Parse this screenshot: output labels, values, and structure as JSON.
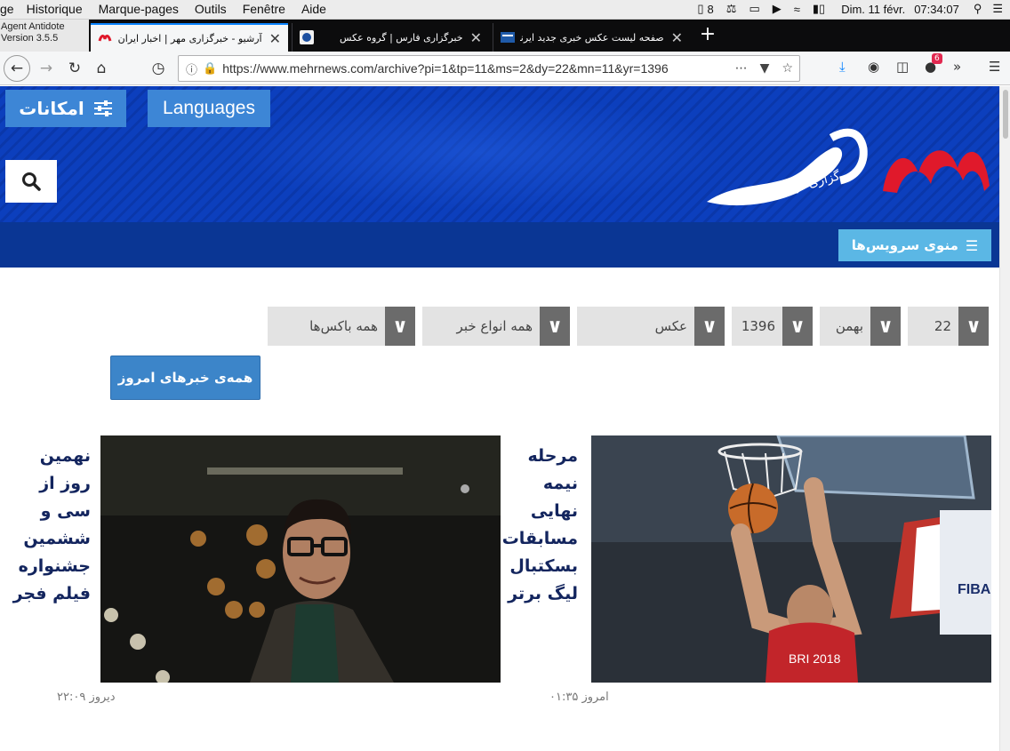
{
  "menubar": {
    "app_fragment": "ge",
    "menus": [
      "Historique",
      "Marque-pages",
      "Outils",
      "Fenêtre",
      "Aide"
    ],
    "adobe_count": "8",
    "date": "Dim. 11 févr.",
    "time": "07:34:07"
  },
  "antidote": {
    "line1": "Agent Antidote",
    "line2": "Version 3.5.5"
  },
  "tabs": [
    {
      "title": "آرشیو - خبرگزاری مهر | اخبار ایران و جهان",
      "active": true
    },
    {
      "title": "خبرگزاری فارس | گروه عکس",
      "active": false
    },
    {
      "title": "صفحه لیست عکس خبری جدید ایرنا",
      "active": false
    }
  ],
  "navbar": {
    "url": "https://www.mehrnews.com/archive?pi=1&tp=11&ms=2&dy=22&mn=11&yr=1396",
    "notifications": "6"
  },
  "header": {
    "options_label": "امکانات",
    "languages_label": "Languages",
    "logo_text": "خبرگزاری مهر",
    "service_menu_label": "منوی سرویس‌ها"
  },
  "filters": [
    {
      "value": "22"
    },
    {
      "value": "بهمن"
    },
    {
      "value": "1396"
    },
    {
      "value": "عکس"
    },
    {
      "value": "همه انواع خبر"
    },
    {
      "value": "همه باکس‌ها"
    }
  ],
  "today_button": "همه‌ی خبرهای امروز",
  "cards": [
    {
      "headline_lines": [
        "مرحله",
        "نیمه",
        "نهایی",
        "مسابقات",
        "بسکتبال",
        "لیگ برتر"
      ],
      "timestamp": "امروز ۰۱:۳۵",
      "jersey": "BRI 2018",
      "banner": "FIBA"
    },
    {
      "headline_lines": [
        "نهمین",
        "روز از",
        "سی و",
        "ششمین",
        "جشنواره",
        "فیلم فجر"
      ],
      "timestamp": "دیروز ۲۲:۰۹"
    }
  ],
  "colors": {
    "header_blue": "#0c3fbd",
    "subnav_blue": "#0a3694",
    "button_blue": "#3d86d6",
    "service_cyan": "#5bb7e5",
    "logo_red": "#e0192b",
    "headline_navy": "#13255e"
  }
}
